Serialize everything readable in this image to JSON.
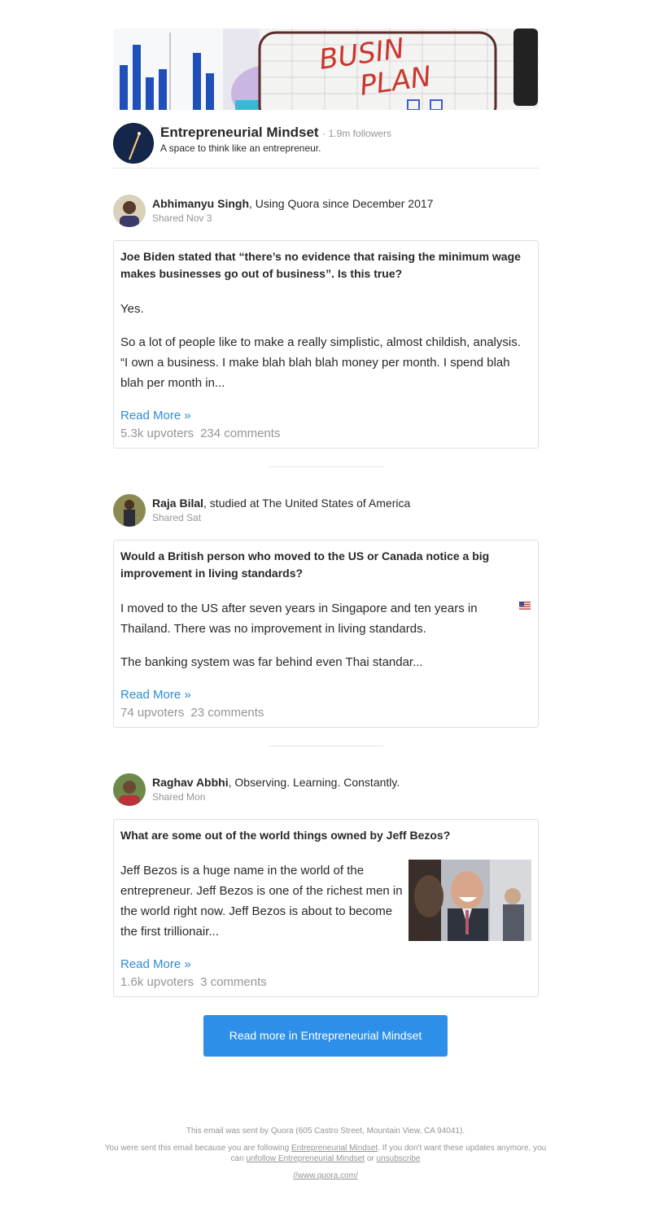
{
  "space": {
    "name": "Entrepreneurial Mindset",
    "followers": "· 1.9m followers",
    "description": "A space to think like an entrepreneur.",
    "banner_words": [
      "BUSIN",
      "PLAN"
    ]
  },
  "posts": [
    {
      "author": "Abhimanyu Singh",
      "credential": ", Using Quora since December 2017",
      "shared": "Shared Nov 3",
      "question": "Joe Biden stated that “there’s no evidence that raising the minimum wage makes businesses go out of business”. Is this true?",
      "paragraphs": [
        "Yes.",
        "So a lot of people like to make a really simplistic, almost childish, analysis. “I own a business. I make blah blah blah money per month. I spend blah blah per month in..."
      ],
      "read_more": "Read More »",
      "upvoters": "5.3k upvoters",
      "comments": "234 comments"
    },
    {
      "author": "Raja Bilal",
      "credential": ", studied at The United States of America",
      "shared": "Shared Sat",
      "question": "Would a British person who moved to the US or Canada notice a big improvement in living standards?",
      "paragraphs": [
        "I moved to the US after seven years in Singapore and ten years in Thailand. There was no improvement in living standards.",
        "The banking system was far behind even Thai standar..."
      ],
      "read_more": "Read More »",
      "upvoters": "74 upvoters",
      "comments": "23 comments"
    },
    {
      "author": "Raghav Abbhi",
      "credential": ", Observing. Learning. Constantly.",
      "shared": "Shared Mon",
      "question": "What are some out of the world things owned by Jeff Bezos?",
      "paragraphs": [
        "Jeff Bezos is a huge name in the world of the entrepreneur. Jeff Bezos is one of the richest men in the world right now. Jeff Bezos is about to become the first trillionair..."
      ],
      "read_more": "Read More »",
      "upvoters": "1.6k upvoters",
      "comments": "3 comments"
    }
  ],
  "cta": "Read more in Entrepreneurial Mindset",
  "footer": {
    "line1": "This email was sent by Quora (605 Castro Street, Mountain View, CA 94041).",
    "line2_a": "You were sent this email because you are following ",
    "line2_link": "Entrepreneurial Mindset",
    "line2_b": ". If you don't want these updates anymore, you can ",
    "unfollow": "unfollow Entrepreneurial Mindset",
    "or": " or ",
    "unsubscribe": "unsubscribe",
    "url": "//www.quora.com/"
  },
  "colors": {
    "link": "#2e8bd5",
    "button": "#2e8fe8",
    "muted": "#939598"
  }
}
